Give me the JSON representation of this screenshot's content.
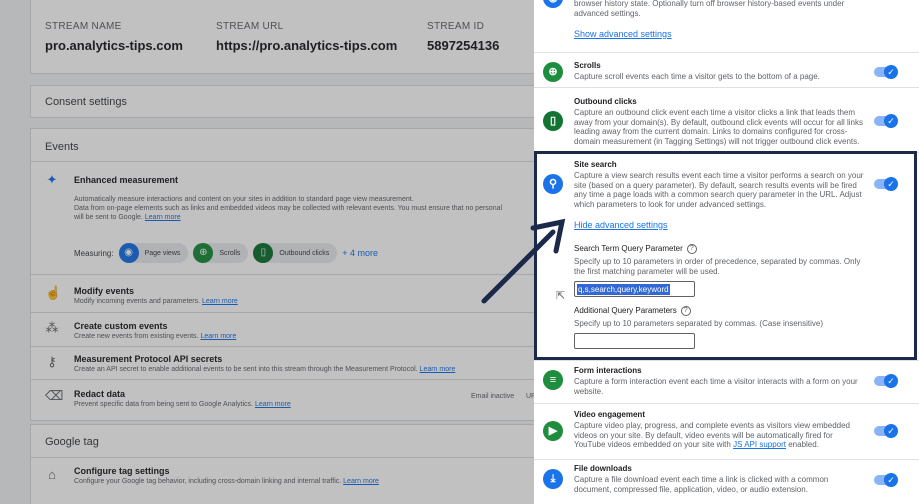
{
  "stream": {
    "name_label": "STREAM NAME",
    "name_value": "pro.analytics-tips.com",
    "url_label": "STREAM URL",
    "url_value": "https://pro.analytics-tips.com",
    "id_label": "STREAM ID",
    "id_value": "5897254136"
  },
  "consent": {
    "title": "Consent settings"
  },
  "events": {
    "title": "Events",
    "enhanced": {
      "title": "Enhanced measurement",
      "desc": "Automatically measure interactions and content on your sites in addition to standard page view measurement.",
      "desc2": "Data from on-page elements such as links and embedded videos may be collected with relevant events. You must ensure that no personal",
      "desc3": "will be sent to Google.",
      "learn_more": "Learn more",
      "measuring_label": "Measuring:",
      "chips": [
        "Page views",
        "Scrolls",
        "Outbound clicks"
      ],
      "more": "+ 4 more"
    },
    "modify": {
      "title": "Modify events",
      "desc": "Modify incoming events and parameters.",
      "learn_more": "Learn more"
    },
    "custom": {
      "title": "Create custom events",
      "desc": "Create new events from existing events.",
      "learn_more": "Learn more"
    },
    "mp": {
      "title": "Measurement Protocol API secrets",
      "desc": "Create an API secret to enable additional events to be sent into this stream through the Measurement Protocol.",
      "learn_more": "Learn more"
    },
    "redact": {
      "title": "Redact data",
      "desc": "Prevent specific data from being sent to Google Analytics.",
      "learn_more": "Learn more",
      "status": "Email inactive",
      "status2": "UR"
    }
  },
  "gtag": {
    "title": "Google tag",
    "configure": {
      "title": "Configure tag settings",
      "desc": "Configure your Google tag behavior, including cross-domain linking and internal traffic.",
      "learn_more": "Learn more"
    }
  },
  "panel": {
    "top_desc": "browser history state. Optionally turn off browser history-based events under advanced settings.",
    "show_advanced": "Show advanced settings",
    "scrolls": {
      "title": "Scrolls",
      "desc": "Capture scroll events each time a visitor gets to the bottom of a page."
    },
    "outbound": {
      "title": "Outbound clicks",
      "desc": "Capture an outbound click event each time a visitor clicks a link that leads them away from your domain(s). By default, outbound click events will occur for all links leading away from the current domain. Links to domains configured for cross-domain measurement (in Tagging Settings) will not trigger outbound click events."
    },
    "site_search": {
      "title": "Site search",
      "desc": "Capture a view search results event each time a visitor performs a search on your site (based on a query parameter). By default, search results events will be fired any time a page loads with a common search query parameter in the URL. Adjust which parameters to look for under advanced settings.",
      "hide_advanced": "Hide advanced settings",
      "term_title": "Search Term Query Parameter",
      "term_desc": "Specify up to 10 parameters in order of precedence, separated by commas. Only the first matching parameter will be used.",
      "term_value": "q,s,search,query,keyword",
      "additional_title": "Additional Query Parameters",
      "additional_desc": "Specify up to 10 parameters separated by commas. (Case insensitive)",
      "additional_value": ""
    },
    "forms": {
      "title": "Form interactions",
      "desc": "Capture a form interaction event each time a visitor interacts with a form on your website."
    },
    "video": {
      "title": "Video engagement",
      "desc_a": "Capture video play, progress, and complete events as visitors view embedded videos on your site. By default, video events will be automatically fired for YouTube videos embedded on your site with",
      "api_link": "JS API support",
      "desc_b": "enabled."
    },
    "files": {
      "title": "File downloads",
      "desc": "Capture a file download event each time a link is clicked with a common document, compressed file, application, video, or audio extension."
    }
  },
  "colors": {
    "blue_icon": "#1a73e8",
    "green_icon": "#1e8e3e",
    "teal_icon": "#137333",
    "highlight_border": "#1b2a4a"
  },
  "icons": {
    "scrolls": "crosshair-icon",
    "outbound": "mouse-icon",
    "site_search": "search-icon",
    "forms": "form-list-icon",
    "video": "play-icon",
    "files": "download-icon"
  }
}
